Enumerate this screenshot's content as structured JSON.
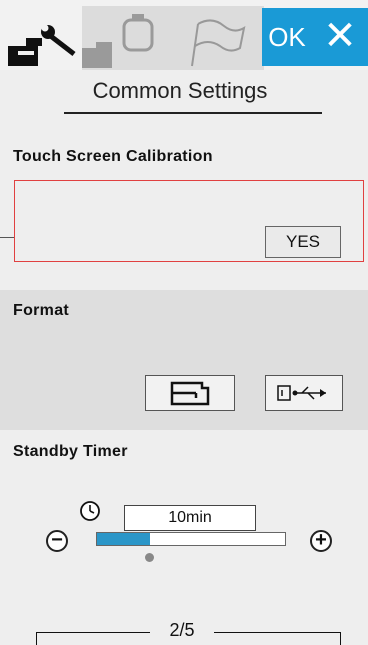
{
  "tabs": {
    "common_icon": "machine-wrench-icon",
    "embroidery_icon": "embroidery-hoop-icon",
    "language_icon": "flag-icon"
  },
  "buttons": {
    "ok_label": "OK",
    "close_label": "✕"
  },
  "header": {
    "title": "Common Settings"
  },
  "sections": {
    "touch_calibration": {
      "label": "Touch Screen Calibration",
      "yes_label": "YES"
    },
    "format": {
      "label": "Format",
      "machine_icon": "machine-memory-icon",
      "usb_icon": "usb-icon"
    },
    "standby": {
      "label": "Standby Timer",
      "clock_icon": "clock-icon",
      "value": "10min",
      "slider_fraction": 0.28,
      "minus_label": "−",
      "plus_label": "+"
    }
  },
  "pager": {
    "text": "2/5"
  },
  "colors": {
    "accent": "#1a9ad6",
    "slider_fill": "#2b96c8",
    "calibration_frame": "#e04040"
  }
}
